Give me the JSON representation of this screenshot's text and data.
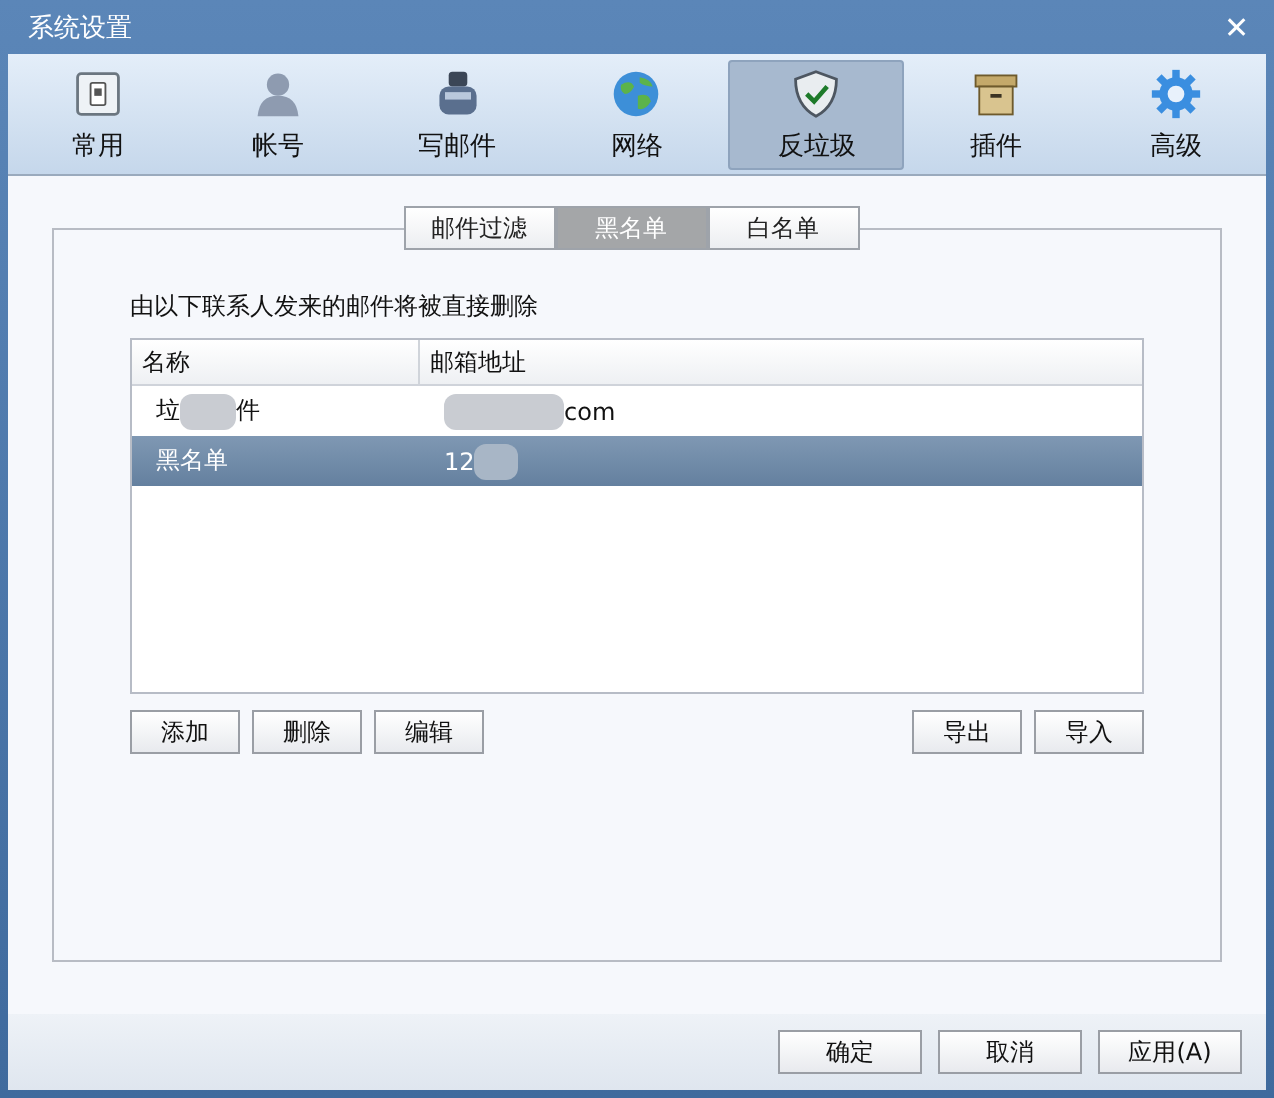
{
  "window": {
    "title": "系统设置",
    "close": "✕"
  },
  "tabs": [
    {
      "label": "常用",
      "selected": false
    },
    {
      "label": "帐号",
      "selected": false
    },
    {
      "label": "写邮件",
      "selected": false
    },
    {
      "label": "网络",
      "selected": false
    },
    {
      "label": "反垃圾",
      "selected": true
    },
    {
      "label": "插件",
      "selected": false
    },
    {
      "label": "高级",
      "selected": false
    }
  ],
  "subtabs": [
    {
      "label": "邮件过滤",
      "selected": false
    },
    {
      "label": "黑名单",
      "selected": true
    },
    {
      "label": "白名单",
      "selected": false
    }
  ],
  "description": "由以下联系人发来的邮件将被直接删除",
  "table": {
    "columns": [
      "名称",
      "邮箱地址"
    ],
    "rows": [
      {
        "selected": false,
        "name": [
          {
            "kind": "text",
            "text": "垃"
          },
          {
            "kind": "blur"
          },
          {
            "kind": "text",
            "text": "件"
          }
        ],
        "email": [
          {
            "kind": "blur"
          },
          {
            "kind": "text",
            "text": "com"
          }
        ]
      },
      {
        "selected": true,
        "name": [
          {
            "kind": "text",
            "text": "黑名单"
          }
        ],
        "email": [
          {
            "kind": "text",
            "text": "12"
          },
          {
            "kind": "blur"
          }
        ]
      }
    ]
  },
  "left_buttons": [
    "添加",
    "删除",
    "编辑"
  ],
  "right_buttons": [
    "导出",
    "导入"
  ],
  "footer_buttons": [
    "确定",
    "取消",
    "应用(A)"
  ]
}
